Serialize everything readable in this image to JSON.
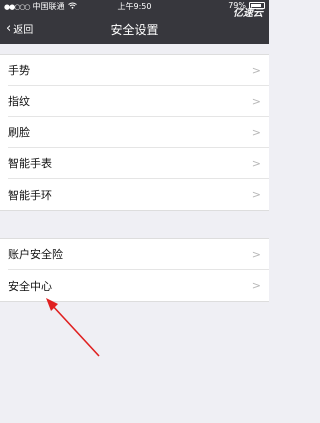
{
  "status_bar": {
    "signal": "●●○○○",
    "carrier": "中国联通",
    "wifi_icon": "wifi-icon",
    "time": "上午9:50",
    "battery_text": "79%",
    "watermark": "亿速云"
  },
  "nav": {
    "back_label": "返回",
    "title": "安全设置"
  },
  "group1": {
    "items": [
      {
        "label": "手势",
        "arrow": ">"
      },
      {
        "label": "指纹",
        "arrow": ">"
      },
      {
        "label": "刷脸",
        "arrow": ">"
      },
      {
        "label": "智能手表",
        "arrow": ">"
      },
      {
        "label": "智能手环",
        "arrow": ">"
      }
    ]
  },
  "group2": {
    "items": [
      {
        "label": "账户安全险",
        "arrow": ">"
      },
      {
        "label": "安全中心",
        "arrow": ">"
      }
    ]
  },
  "colors": {
    "nav_bg": "#37373d",
    "page_bg": "#efeff4",
    "annotation_arrow": "#e02020"
  }
}
